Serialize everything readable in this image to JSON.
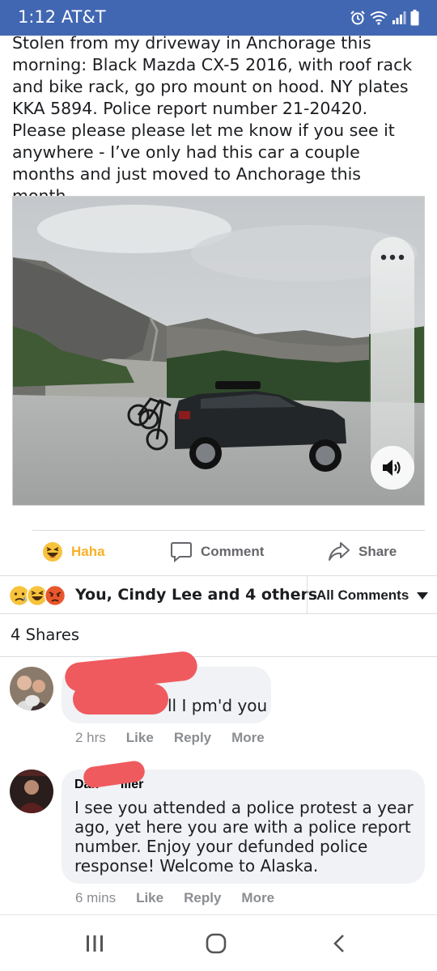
{
  "status_bar": {
    "time": "1:12 AT&T",
    "icons": [
      "alarm-icon",
      "wifi-icon",
      "signal-icon",
      "battery-icon"
    ]
  },
  "post": {
    "text": "Stolen from my driveway in Anchorage this morning: Black Mazda CX-5 2016, with roof rack and bike rack, go pro mount on hood. NY plates KKA 5894. Police report number 21-20420. Please please please let me know if you see it anywhere - I’ve only had this car a couple months and just moved to Anchorage this month.",
    "photo_icons": [
      "more-options-icon",
      "volume-icon"
    ]
  },
  "actions": {
    "haha_label": "Haha",
    "comment_label": "Comment",
    "share_label": "Share"
  },
  "reactions": {
    "summary": "You, Cindy Lee and 4 others",
    "icons": [
      "sad-face-icon",
      "haha-face-icon",
      "angry-face-icon"
    ],
    "filter_label": "All Comments"
  },
  "shares": {
    "count_label": "4 Shares"
  },
  "comments": [
    {
      "name": "",
      "text": "ll I pm'd you",
      "time": "2 hrs",
      "like": "Like",
      "reply": "Reply",
      "more": "More"
    },
    {
      "name": "Dan      iller",
      "text": "I see you attended a police protest a year ago, yet here you are with a police report number. Enjoy your defunded police response! Welcome to Alaska.",
      "time": "6 mins",
      "like": "Like",
      "reply": "Reply",
      "more": "More"
    }
  ],
  "nav_bar": {
    "icons": [
      "recent-apps-icon",
      "home-icon",
      "back-icon"
    ]
  },
  "colors": {
    "status_bar": "#4267b2",
    "haha": "#f7b125",
    "redaction": "#ef5a5f",
    "bubble": "#f0f2f5",
    "meta_text": "#8a8d91"
  }
}
